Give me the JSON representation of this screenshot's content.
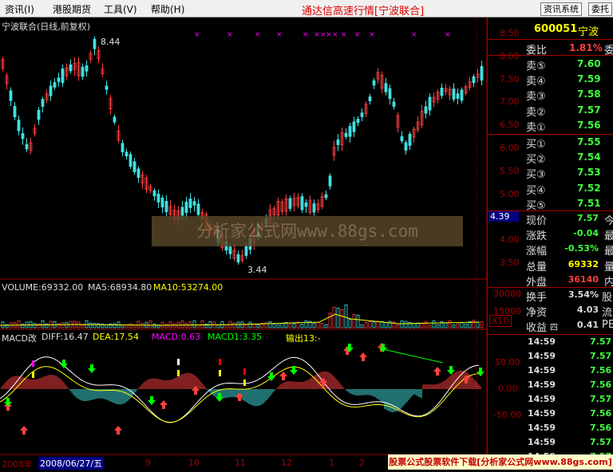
{
  "menu": {
    "items": [
      "资讯(I)",
      "港股期货",
      "工具(V)",
      "帮助(H)"
    ]
  },
  "app_title": "通达信高速行情[宁波联合]",
  "top_buttons": [
    "资讯系统",
    "委托"
  ],
  "chart": {
    "title": "宁波联合(日线,前复权)",
    "price_axis": [
      "8.50",
      "8.00",
      "7.50",
      "7.00",
      "6.50",
      "6.00",
      "5.50",
      "5.00",
      "4.50",
      "4.00",
      "3.50"
    ],
    "high_label": "8.44",
    "low_label": "3.44",
    "cursor_price": "4.39",
    "watermark": "分析家公式网www.88gs.com",
    "volume_header": {
      "name": "VOLUME:69332.00",
      "ma5": "MA5:68934.80",
      "ma10": "MA10:53274.00"
    },
    "volume_axis": [
      "30000",
      "15000"
    ],
    "volume_unit": "X10",
    "macd_header": {
      "name": "MACD改",
      "diff": "DIFF:16.47",
      "dea": "DEA:17.54",
      "macd": "MACD:0.63",
      "macd1": "MACD1:3.35",
      "out": "输出13:-"
    },
    "macd_axis": [
      "50.00",
      "0.00",
      "-50.00"
    ],
    "date_axis": {
      "year": "2008年",
      "cursor_date": "2008/06/27/五",
      "months": [
        "9",
        "10",
        "11",
        "12",
        "1",
        "2"
      ]
    },
    "colors": {
      "up": "#ff4040",
      "down": "#40e0e0",
      "accent": "#ff00ff",
      "axis": "#a00000"
    }
  },
  "quote": {
    "code": "600051",
    "name": "宁波",
    "webi": {
      "label": "委比",
      "value": "1.81%",
      "right": "委"
    },
    "asks": [
      {
        "label": "卖⑤",
        "price": "7.60"
      },
      {
        "label": "卖④",
        "price": "7.59"
      },
      {
        "label": "卖③",
        "price": "7.58"
      },
      {
        "label": "卖②",
        "price": "7.57"
      },
      {
        "label": "卖①",
        "price": "7.56"
      }
    ],
    "bids": [
      {
        "label": "买①",
        "price": "7.55"
      },
      {
        "label": "买②",
        "price": "7.54"
      },
      {
        "label": "买③",
        "price": "7.53"
      },
      {
        "label": "买④",
        "price": "7.52"
      },
      {
        "label": "买⑤",
        "price": "7.51"
      }
    ],
    "stats": [
      {
        "label": "现价",
        "value": "7.57",
        "right": "今"
      },
      {
        "label": "涨跌",
        "value": "-0.04",
        "right": "最"
      },
      {
        "label": "涨幅",
        "value": "-0.53%",
        "right": "最"
      },
      {
        "label": "总量",
        "value": "69332",
        "right": "量"
      },
      {
        "label": "外盘",
        "value": "36140",
        "right": "内"
      }
    ],
    "fin": [
      {
        "label": "换手",
        "value": "3.54%",
        "right": "股"
      },
      {
        "label": "净资",
        "value": "4.03",
        "right": "流"
      },
      {
        "label": "收益",
        "sub": "四",
        "value": "0.41",
        "right": "PE"
      }
    ],
    "ticks": [
      {
        "time": "14:59",
        "price": "7.57"
      },
      {
        "time": "14:59",
        "price": "7.57"
      },
      {
        "time": "14:59",
        "price": "7.56"
      },
      {
        "time": "14:59",
        "price": "7.56"
      },
      {
        "time": "14:59",
        "price": "7.57"
      },
      {
        "time": "14:59",
        "price": "7.56"
      },
      {
        "time": "14:59",
        "price": "7.56"
      },
      {
        "time": "14:59",
        "price": "7.57"
      },
      {
        "time": "14:59",
        "price": "7.57"
      }
    ]
  },
  "bottom_ad": "股票公式股票软件下载[分析家公式网www.88gs.com]"
}
